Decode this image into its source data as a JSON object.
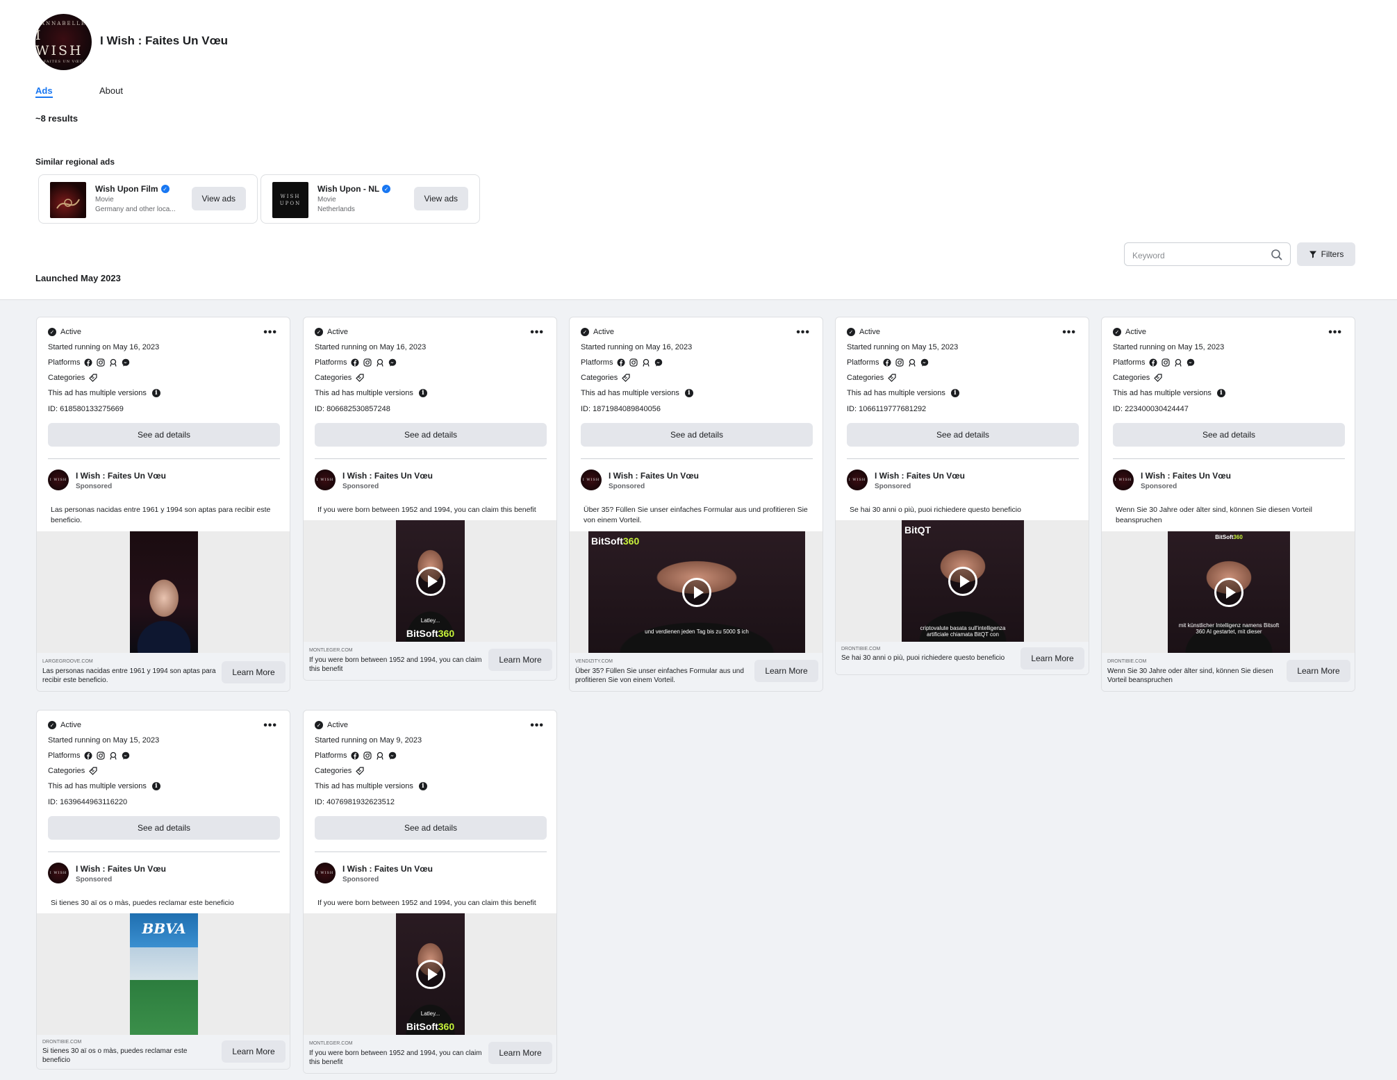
{
  "page": {
    "avatar_lines": [
      "ANNABELLE",
      "I WISH",
      "FAITES UN VŒU"
    ],
    "title": "I Wish : Faites Un Vœu",
    "tabs": {
      "ads": "Ads",
      "about": "About"
    },
    "results": "~8 results",
    "similar_label": "Similar regional ads",
    "launched": "Launched May 2023"
  },
  "similar": [
    {
      "name": "Wish Upon Film",
      "category": "Movie",
      "location": "Germany and other loca...",
      "button": "View ads"
    },
    {
      "name": "Wish Upon - NL",
      "category": "Movie",
      "location": "Netherlands",
      "button": "View ads",
      "thumb_text": "WISH UPON"
    }
  ],
  "search": {
    "placeholder": "Keyword"
  },
  "filters_label": "Filters",
  "card_labels": {
    "status": "Active",
    "platforms": "Platforms",
    "categories": "Categories",
    "multi": "This ad has multiple versions",
    "see": "See ad details",
    "page_name": "I Wish : Faites Un Vœu",
    "sponsored": "Sponsored",
    "avatar_text": "I WISH",
    "learn": "Learn More"
  },
  "cards": [
    {
      "started": "Started running on May 16, 2023",
      "id": "ID: 618580133275669",
      "body": "Las personas nacidas entre 1961 y 1994 son aptas para recibir este beneficio.",
      "domain": "LARGEGROOVE.COM",
      "ftext": "Las personas nacidas entre 1961 y 1994 son aptas para recibir este beneficio.",
      "caption": "",
      "brand": ""
    },
    {
      "started": "Started running on May 16, 2023",
      "id": "ID: 806682530857248",
      "body": "If you were born between 1952 and 1994, you can claim this benefit",
      "domain": "MONTLEGER.COM",
      "ftext": "If you were born between 1952 and 1994, you can claim this benefit",
      "caption": "Latley...",
      "brand": "BitSoft",
      "brand2": "360"
    },
    {
      "started": "Started running on May 16, 2023",
      "id": "ID: 1871984089840056",
      "body": "Über 35? Füllen Sie unser einfaches Formular aus und profitieren Sie von einem Vorteil.",
      "domain": "VENDIZITY.COM",
      "ftext": "Über 35? Füllen Sie unser einfaches Formular aus und profitieren Sie von einem Vorteil.",
      "caption": "und verdienen jeden Tag bis zu 5000 $ ich",
      "brand": "BitSoft",
      "brand2": "360"
    },
    {
      "started": "Started running on May 15, 2023",
      "id": "ID: 1066119777681292",
      "body": "Se hai 30 anni o più, puoi richiedere questo beneficio",
      "domain": "DRONTIBIE.COM",
      "ftext": "Se hai 30 anni o più, puoi richiedere questo beneficio",
      "caption": "criptovalute basata sull'intelligenza artificiale chiamata BitQT con",
      "brand": "BitQT",
      "brand2": ""
    },
    {
      "started": "Started running on May 15, 2023",
      "id": "ID: 223400030424447",
      "body": "Wenn Sie 30 Jahre oder älter sind, können Sie diesen Vorteil beanspruchen",
      "domain": "DRONTIBIE.COM",
      "ftext": "Wenn Sie 30 Jahre oder älter sind, können Sie diesen Vorteil beanspruchen",
      "caption": "mit künstlicher Intelligenz namens Bitsoft 360 AI gestartet, mit dieser",
      "brand": "BitSoft",
      "brand2": "360"
    },
    {
      "started": "Started running on May 15, 2023",
      "id": "ID: 1639644963116220",
      "body": "Si tienes 30 aï os o màs, puedes reclamar este beneficio",
      "domain": "DRONTIBIE.COM",
      "ftext": "Si tienes 30 aï os o màs, puedes reclamar este beneficio",
      "caption": "",
      "brand": "BBVA",
      "brand2": ""
    },
    {
      "started": "Started running on May 9, 2023",
      "id": "ID: 4076981932623512",
      "body": "If you were born between 1952 and 1994, you can claim this benefit",
      "domain": "MONTLEGER.COM",
      "ftext": "If you were born between 1952 and 1994, you can claim this benefit",
      "caption": "Latley...",
      "brand": "BitSoft",
      "brand2": "360"
    }
  ]
}
